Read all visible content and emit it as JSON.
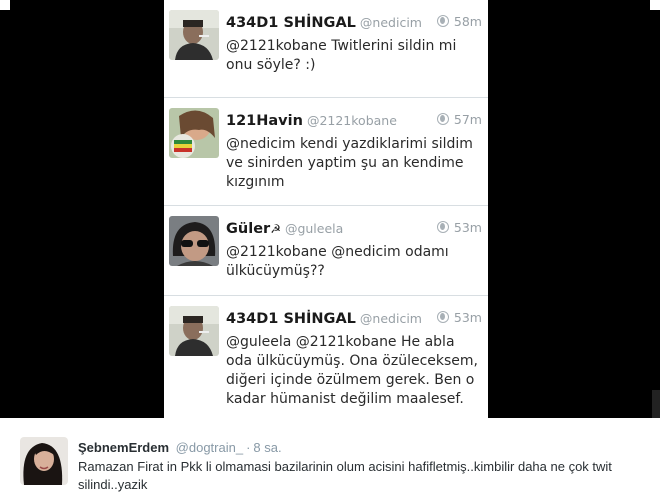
{
  "embedded_tweets": [
    {
      "name": "434D1 SHİNGAL",
      "handle": "@nedicim",
      "time": "58m",
      "text": "@2121kobane Twitlerini sildin mi onu söyle? :)",
      "avatar": "man-smoking-avatar"
    },
    {
      "name": "121Havin",
      "handle": "@2121kobane",
      "time": "57m",
      "text": "@nedicim kendi yazdiklarimi sildim ve sinirden yaptim şu an kendime kızgınım",
      "avatar": "woman-with-flag-avatar"
    },
    {
      "name": "Güler",
      "name_symbol": "☭",
      "handle": "@guleela",
      "time": "53m",
      "text": "@2121kobane @nedicim odamı ülkücüymüş??",
      "avatar": "woman-sunglasses-avatar"
    },
    {
      "name": "434D1 SHİNGAL",
      "handle": "@nedicim",
      "time": "53m",
      "text": "@guleela @2121kobane He abla oda ülkücüymüş. Ona özüleceksem, diğeri içinde özülmem gerek. Ben o kadar hümanist değilim maalesef.",
      "avatar": "man-smoking-avatar"
    }
  ],
  "main_tweet": {
    "name": "ŞebnemErdem",
    "handle": "@dogtrain_",
    "separator": "·",
    "time": "8 sa.",
    "text": "Ramazan Firat in Pkk li olmamasi bazilarinin olum acisini hafifletmiş..kimbilir daha ne çok twit silindi..yazik",
    "avatar": "woman-dark-hair-avatar"
  },
  "colors": {
    "background_dark": "#000000",
    "timeline_bg": "#eef2f4",
    "muted_text": "#98a0a6",
    "body_text": "#292f33"
  }
}
